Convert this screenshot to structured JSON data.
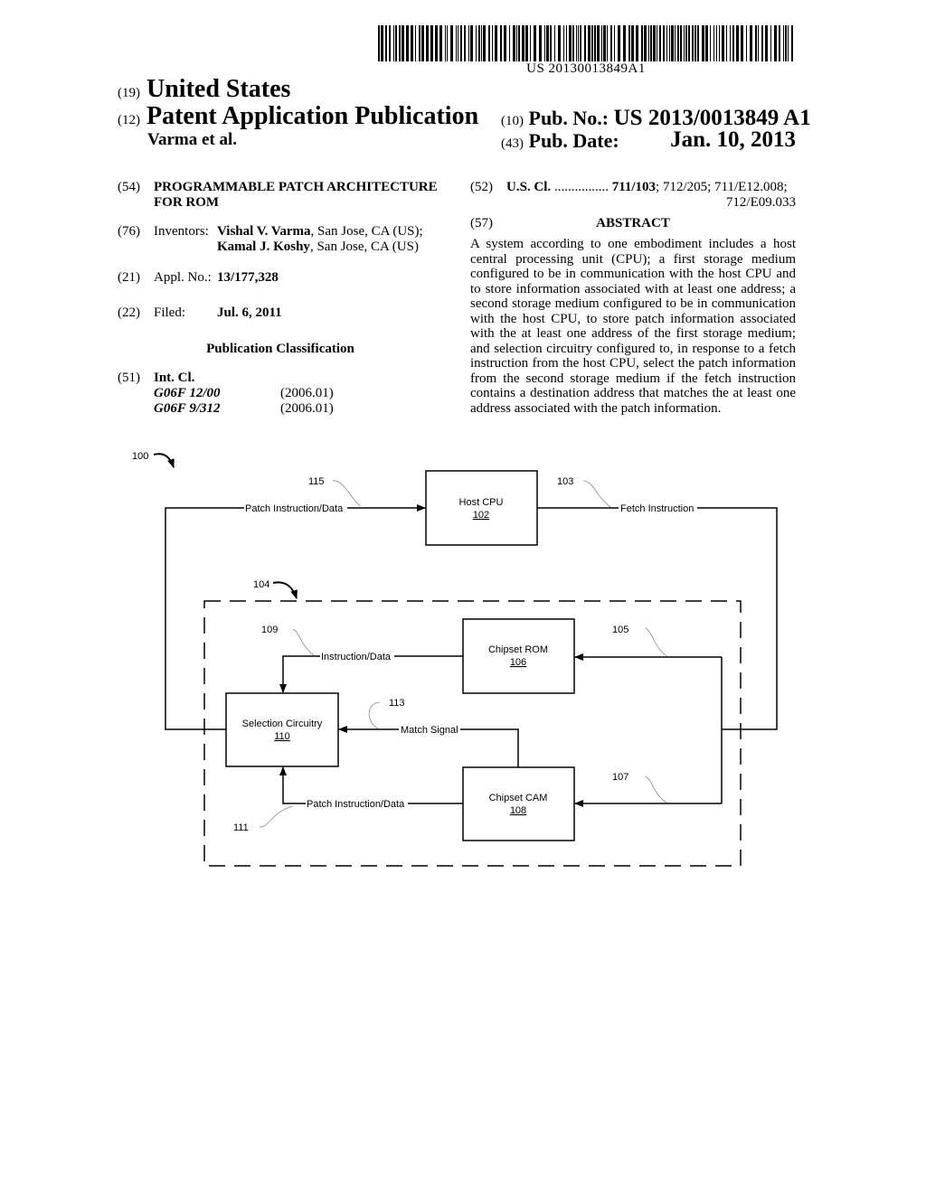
{
  "header": {
    "barcode_number": "US 20130013849A1",
    "country_code": "(19)",
    "country": "United States",
    "pub_type_code": "(12)",
    "pub_type": "Patent Application Publication",
    "inventors_short": "Varma et al.",
    "pub_no_code": "(10)",
    "pub_no_label": "Pub. No.:",
    "pub_no": "US 2013/0013849 A1",
    "pub_date_code": "(43)",
    "pub_date_label": "Pub. Date:",
    "pub_date": "Jan. 10, 2013"
  },
  "left_column": {
    "title_code": "(54)",
    "title_line1": "PROGRAMMABLE PATCH ARCHITECTURE",
    "title_line2": "FOR ROM",
    "inventors_code": "(76)",
    "inventors_label": "Inventors:",
    "inventor1_name": "Vishal V. Varma",
    "inventor1_loc": ", San Jose, CA (US);",
    "inventor2_name": "Kamal J. Koshy",
    "inventor2_loc": ", San Jose, CA (US)",
    "appl_code": "(21)",
    "appl_label": "Appl. No.:",
    "appl_no": "13/177,328",
    "filed_code": "(22)",
    "filed_label": "Filed:",
    "filed_date": "Jul. 6, 2011",
    "classification_heading": "Publication Classification",
    "int_cl_code": "(51)",
    "int_cl_label": "Int. Cl.",
    "int_cl": [
      {
        "code": "G06F 12/00",
        "version": "(2006.01)"
      },
      {
        "code": "G06F 9/312",
        "version": "(2006.01)"
      }
    ]
  },
  "right_column": {
    "us_cl_code": "(52)",
    "us_cl_label": "U.S. Cl.",
    "us_cl_dots": "................",
    "us_cl_primary": "711/103",
    "us_cl_rest": "; 712/205; 711/E12.008;",
    "us_cl_line2": "712/E09.033",
    "abstract_code": "(57)",
    "abstract_heading": "ABSTRACT",
    "abstract_text": "A system according to one embodiment includes a host central processing unit (CPU); a first storage medium configured to be in communication with the host CPU and to store information associated with at least one address; a second storage medium configured to be in communication with the host CPU, to store patch information associated with the at least one address of the first storage medium; and selection circuitry configured to, in response to a fetch instruction from the host CPU, select the patch information from the second storage medium if the fetch instruction contains a destination address that matches the at least one address associated with the patch information."
  },
  "diagram": {
    "figure_ref": "100",
    "subsystem_ref": "104",
    "blocks": {
      "host_cpu": {
        "label": "Host CPU",
        "ref": "102"
      },
      "chipset_rom": {
        "label": "Chipset ROM",
        "ref": "106"
      },
      "chipset_cam": {
        "label": "Chipset CAM",
        "ref": "108"
      },
      "selection": {
        "label": "Selection Circuitry",
        "ref": "110"
      }
    },
    "signals": {
      "patch_top": {
        "label": "Patch Instruction/Data",
        "ref": "115"
      },
      "fetch": {
        "label": "Fetch Instruction",
        "ref": "103"
      },
      "rom_in": {
        "ref": "105"
      },
      "cam_in": {
        "ref": "107"
      },
      "rom_out": {
        "label": "Instruction/Data",
        "ref": "109"
      },
      "match": {
        "label": "Match Signal",
        "ref": "113"
      },
      "patch_cam": {
        "label": "Patch Instruction/Data",
        "ref": "111"
      }
    }
  }
}
